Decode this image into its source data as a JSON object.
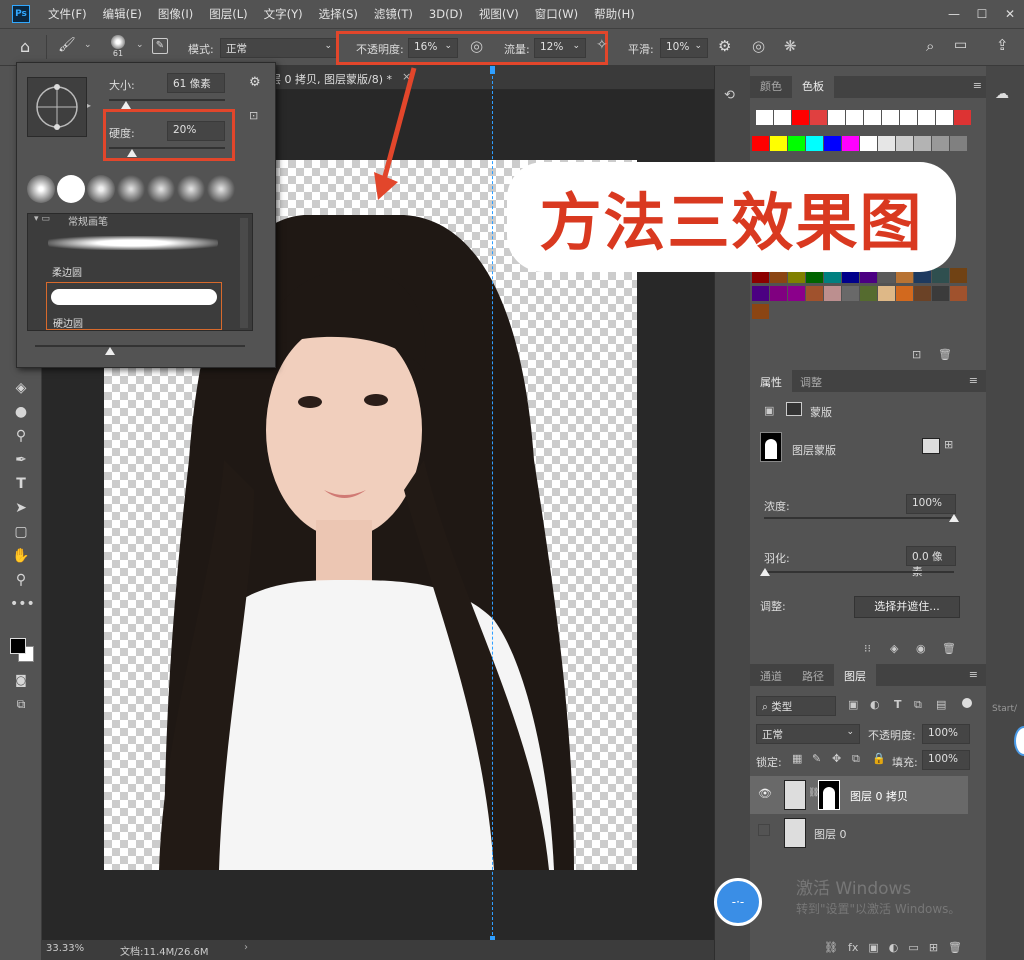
{
  "menubar": {
    "logo": "Ps",
    "items": [
      "文件(F)",
      "编辑(E)",
      "图像(I)",
      "图层(L)",
      "文字(Y)",
      "选择(S)",
      "滤镜(T)",
      "3D(D)",
      "视图(V)",
      "窗口(W)",
      "帮助(H)"
    ],
    "controls": [
      "—",
      "☐",
      "✕"
    ]
  },
  "options": {
    "brush_size_badge": "61",
    "mode_label": "模式:",
    "mode_value": "正常",
    "opacity_label": "不透明度:",
    "opacity_value": "16%",
    "flow_label": "流量:",
    "flow_value": "12%",
    "smooth_label": "平滑:",
    "smooth_value": "10%"
  },
  "document": {
    "tab_title": "层 0 拷贝, 图层蒙版/8) *",
    "zoom": "33.33%",
    "doc_info": "文档:11.4M/26.6M"
  },
  "brush_popup": {
    "size_label": "大小:",
    "size_value": "61 像素",
    "size_slider": 0.15,
    "hardness_label": "硬度:",
    "hardness_value": "20%",
    "hardness_slider": 0.2,
    "folder_label": "常规画笔",
    "brush_soft": "柔边圆",
    "brush_hard": "硬边圆"
  },
  "annotation": {
    "title": "方法三效果图",
    "accent": "#e2462b"
  },
  "color_panel": {
    "tabs": [
      "颜色",
      "色板"
    ],
    "row1": [
      "#ffffff",
      "#ffffff",
      "#ff0000",
      "#e04040",
      "#ffffff",
      "#ffffff",
      "#ffffff",
      "#ffffff",
      "#ffffff",
      "#ffffff",
      "#ffffff",
      "#dd3333"
    ],
    "row2": [
      "#ff0000",
      "#ffff00",
      "#00ff00",
      "#00ffff",
      "#0000ff",
      "#ff00ff",
      "#ffffff",
      "#e6e6e6",
      "#cccccc",
      "#b3b3b3",
      "#999999",
      "#808080"
    ],
    "row_dark1": [
      "#8b0000",
      "#8b4513",
      "#808000",
      "#006400",
      "#008080",
      "#00008b",
      "#4b0082",
      "#5a5a5a",
      "#b87333",
      "#1e3a5f",
      "#2f4f4f",
      "#704214"
    ],
    "row_dark2": [
      "#4b0082",
      "#800080",
      "#8b008b",
      "#a0522d",
      "#bc8f8f",
      "#696969",
      "#556b2f",
      "#deb887",
      "#d2691e",
      "#6b4226",
      "#3b3b3b",
      "#a0522d"
    ]
  },
  "properties": {
    "tabs": [
      "属性",
      "调整"
    ],
    "mask_label": "蒙版",
    "layer_mask_label": "图层蒙版",
    "density_label": "浓度:",
    "density_value": "100%",
    "feather_label": "羽化:",
    "feather_value": "0.0 像素",
    "adjust_label": "调整:",
    "select_mask_button": "选择并遮住..."
  },
  "layers": {
    "tabs": [
      "通道",
      "路径",
      "图层"
    ],
    "filter_label": "类型",
    "blend_mode": "正常",
    "opacity_label": "不透明度:",
    "opacity_value": "100%",
    "lock_label": "锁定:",
    "fill_label": "填充:",
    "fill_value": "100%",
    "items": [
      {
        "name": "图层 0 拷贝"
      },
      {
        "name": "图层 0"
      }
    ]
  },
  "watermark": {
    "line1": "激活 Windows",
    "line2": "转到\"设置\"以激活 Windows。"
  },
  "edge_label": "Start/"
}
